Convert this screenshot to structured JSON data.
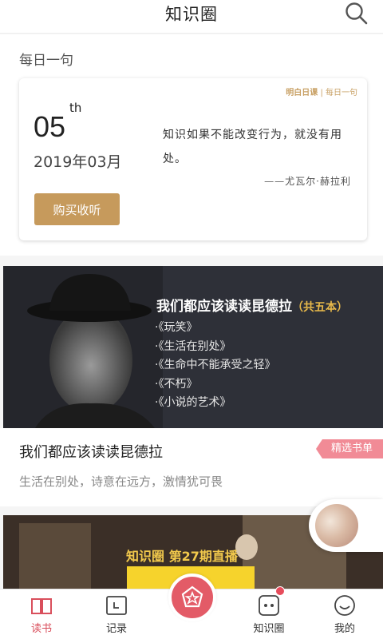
{
  "header": {
    "title": "知识圈"
  },
  "daily": {
    "label": "每日一句",
    "brand_a": "明白日课",
    "brand_b": "每日一句",
    "day": "05",
    "day_suffix": "th",
    "date": "2019年03月",
    "quote": "知识如果不能改变行为，就没有用处。",
    "author": "——尤瓦尔·赫拉利",
    "buy_label": "购买收听"
  },
  "banner1": {
    "title": "我们都应该读读昆德拉",
    "count": "（共五本）",
    "books": [
      "·《玩笑》",
      "·《生活在别处》",
      "·《生命中不能承受之轻》",
      "·《不朽》",
      "·《小说的艺术》"
    ]
  },
  "article": {
    "title": "我们都应该读读昆德拉",
    "subtitle": "生活在别处，诗意在远方，激情犹可畏",
    "tag": "精选书单"
  },
  "banner2": {
    "text": "知识圈 第27期直播"
  },
  "tabs": [
    {
      "label": "读书",
      "icon": "book-icon",
      "active": true
    },
    {
      "label": "记录",
      "icon": "calendar-icon",
      "active": false
    },
    {
      "label": "",
      "icon": "star-pentagon-icon",
      "active": false
    },
    {
      "label": "知识圈",
      "icon": "chat-icon",
      "active": false
    },
    {
      "label": "我的",
      "icon": "smiley-icon",
      "active": false
    }
  ],
  "colors": {
    "accent": "#e35b67",
    "gold": "#c69a5c",
    "tag": "#f18b96"
  }
}
